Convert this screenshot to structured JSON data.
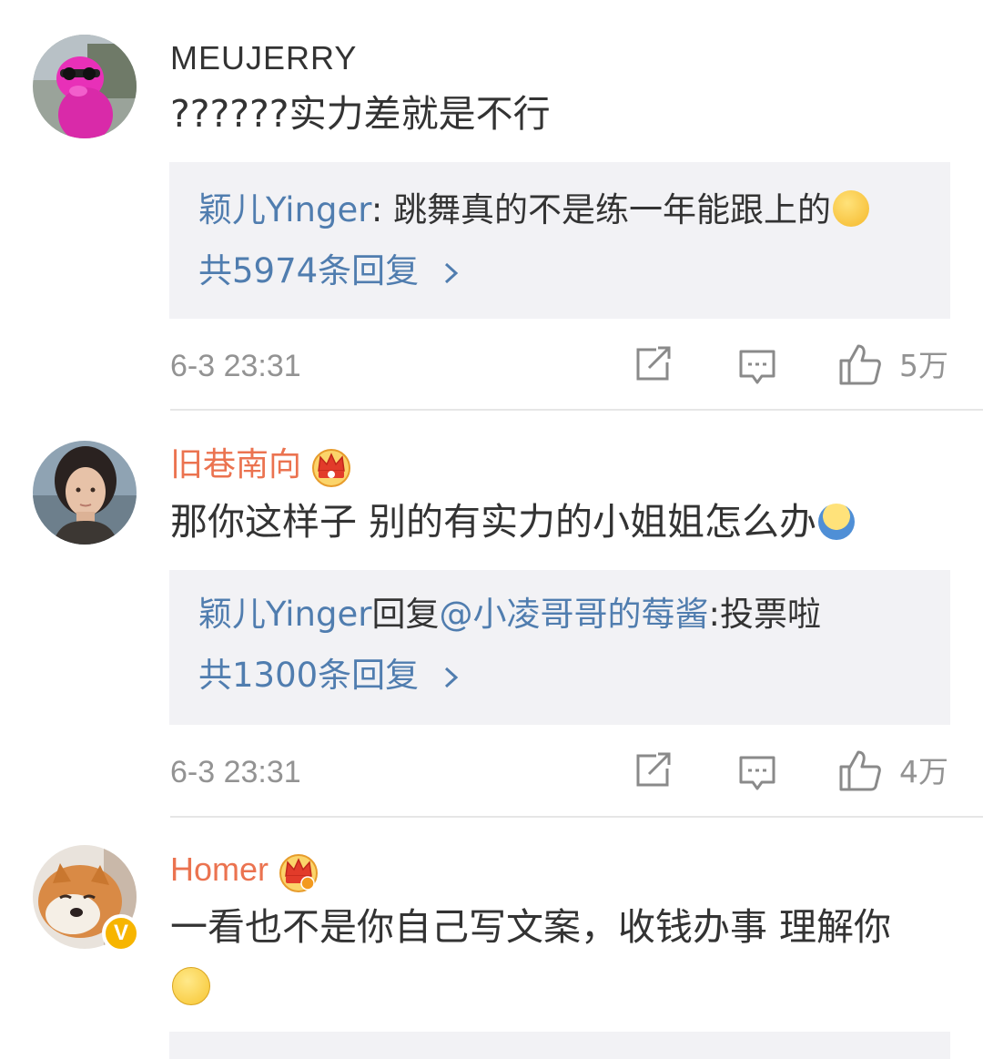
{
  "comments": [
    {
      "username": "MEUJERRY",
      "text": "??????实力差就是不行",
      "reply_preview": {
        "author": "颖儿Yinger",
        "separator": ": ",
        "text": "跳舞真的不是练一年能跟上的",
        "emoji": "thinking-face-emoji"
      },
      "reply_count": "共5974条回复",
      "timestamp": "6-3 23:31",
      "likes": "5万"
    },
    {
      "username": "旧巷南向",
      "badge": "crown-badge-icon",
      "text": "那你这样子 别的有实力的小姐姐怎么办",
      "text_emoji": "shrug-emoji",
      "reply_preview": {
        "author": "颖儿Yinger",
        "reply_word": "回复",
        "mention": "@小凌哥哥的莓酱",
        "separator": ":",
        "text": "投票啦"
      },
      "reply_count": "共1300条回复",
      "timestamp": "6-3 23:31",
      "likes": "4万"
    },
    {
      "username": "Homer",
      "badge": "crown-badge-icon",
      "verified": "verified-v-badge",
      "text": "一看也不是你自己写文案，收钱办事 理解你",
      "text_emoji": "smile-emoji"
    }
  ],
  "colors": {
    "vip_name": "#eb7350",
    "link": "#507daf",
    "meta": "#939393",
    "reply_bg": "#f2f2f5"
  }
}
